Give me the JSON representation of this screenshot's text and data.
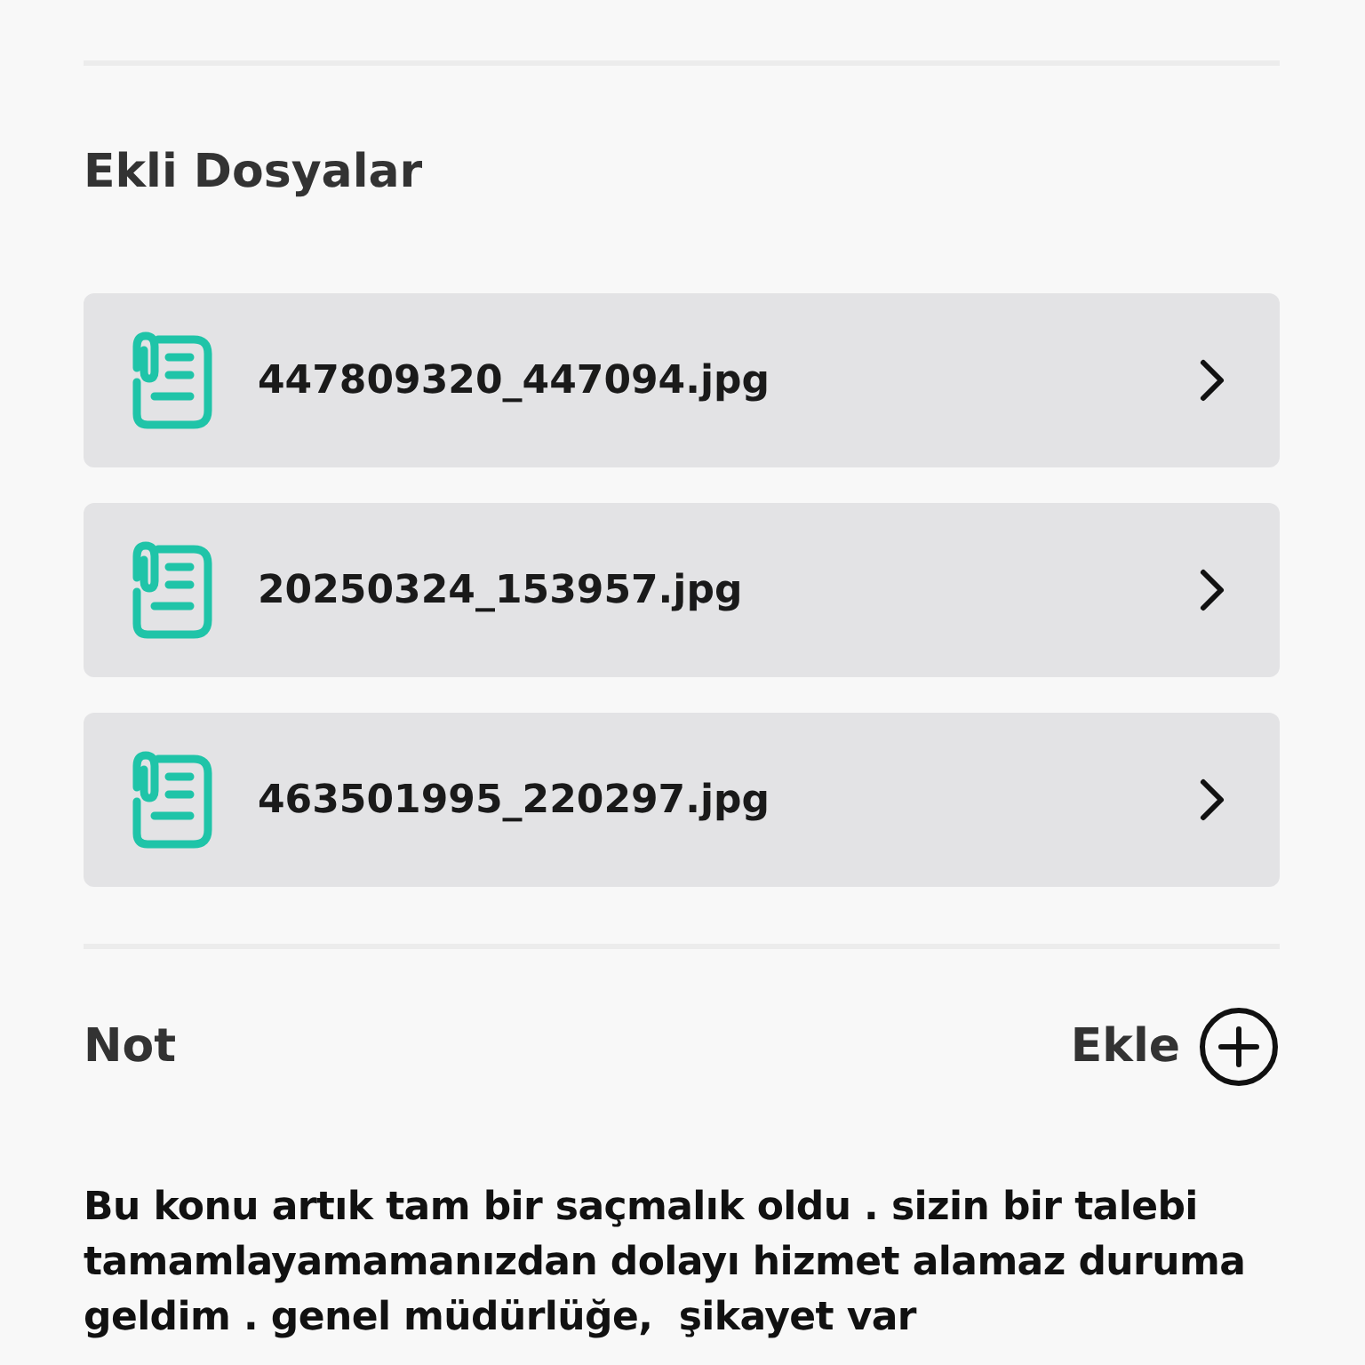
{
  "attachments": {
    "title": "Ekli Dosyalar",
    "files": [
      {
        "name": "447809320_447094.jpg"
      },
      {
        "name": "20250324_153957.jpg"
      },
      {
        "name": "463501995_220297.jpg"
      }
    ]
  },
  "note": {
    "title": "Not",
    "add_label": "Ekle",
    "text": "Bu konu artık tam bir saçmalık oldu . sizin bir talebi tamamlayamamanızdan dolayı hizmet alamaz duruma geldim . genel müdürlüğe,  şikayet var"
  }
}
